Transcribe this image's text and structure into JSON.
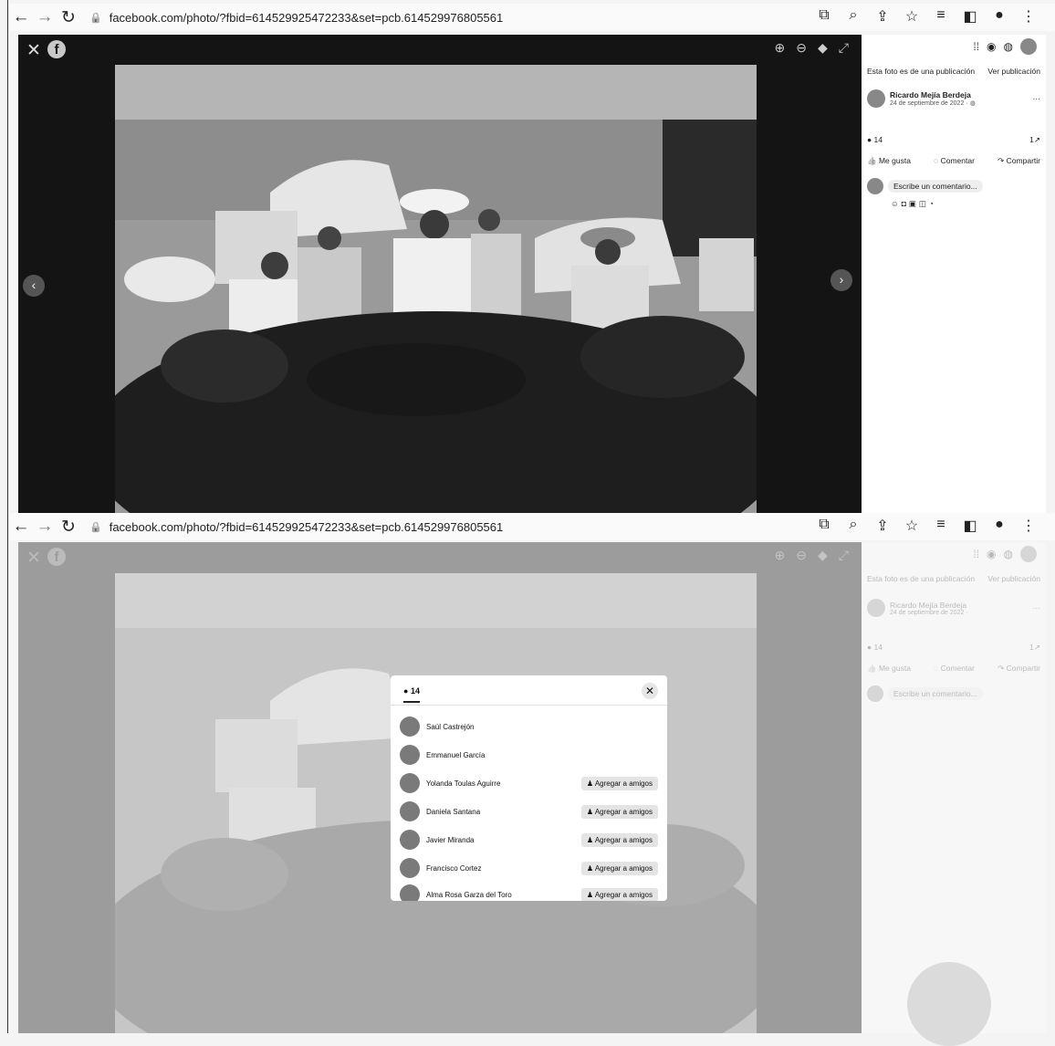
{
  "browser": {
    "url": "facebook.com/photo/?fbid=614529925472233&set=pcb.614529976805561"
  },
  "post": {
    "source_note": "Esta foto es de una publicación",
    "view_post": "Ver publicación",
    "author": "Ricardo Mejía Berdeja",
    "date": "24 de septiembre de 2022 · ",
    "reaction_count": "14",
    "share_count": "1",
    "like_label": "Me gusta",
    "comment_label": "Comentar",
    "share_label": "Compartir",
    "comment_placeholder": "Escribe un comentario..."
  },
  "reactions_modal": {
    "tab_all_count": "14",
    "add_friend_label": "Agregar a amigos",
    "people": [
      {
        "name": "Saúl Castrejón",
        "add_friend": false
      },
      {
        "name": "Emmanuel García",
        "add_friend": false
      },
      {
        "name": "Yolanda Toulas Aguirre",
        "add_friend": true
      },
      {
        "name": "Daniela Santana",
        "add_friend": true
      },
      {
        "name": "Javier Miranda",
        "add_friend": true
      },
      {
        "name": "Francisco Cortez",
        "add_friend": true
      },
      {
        "name": "Alma Rosa Garza del Toro",
        "add_friend": true
      }
    ]
  }
}
